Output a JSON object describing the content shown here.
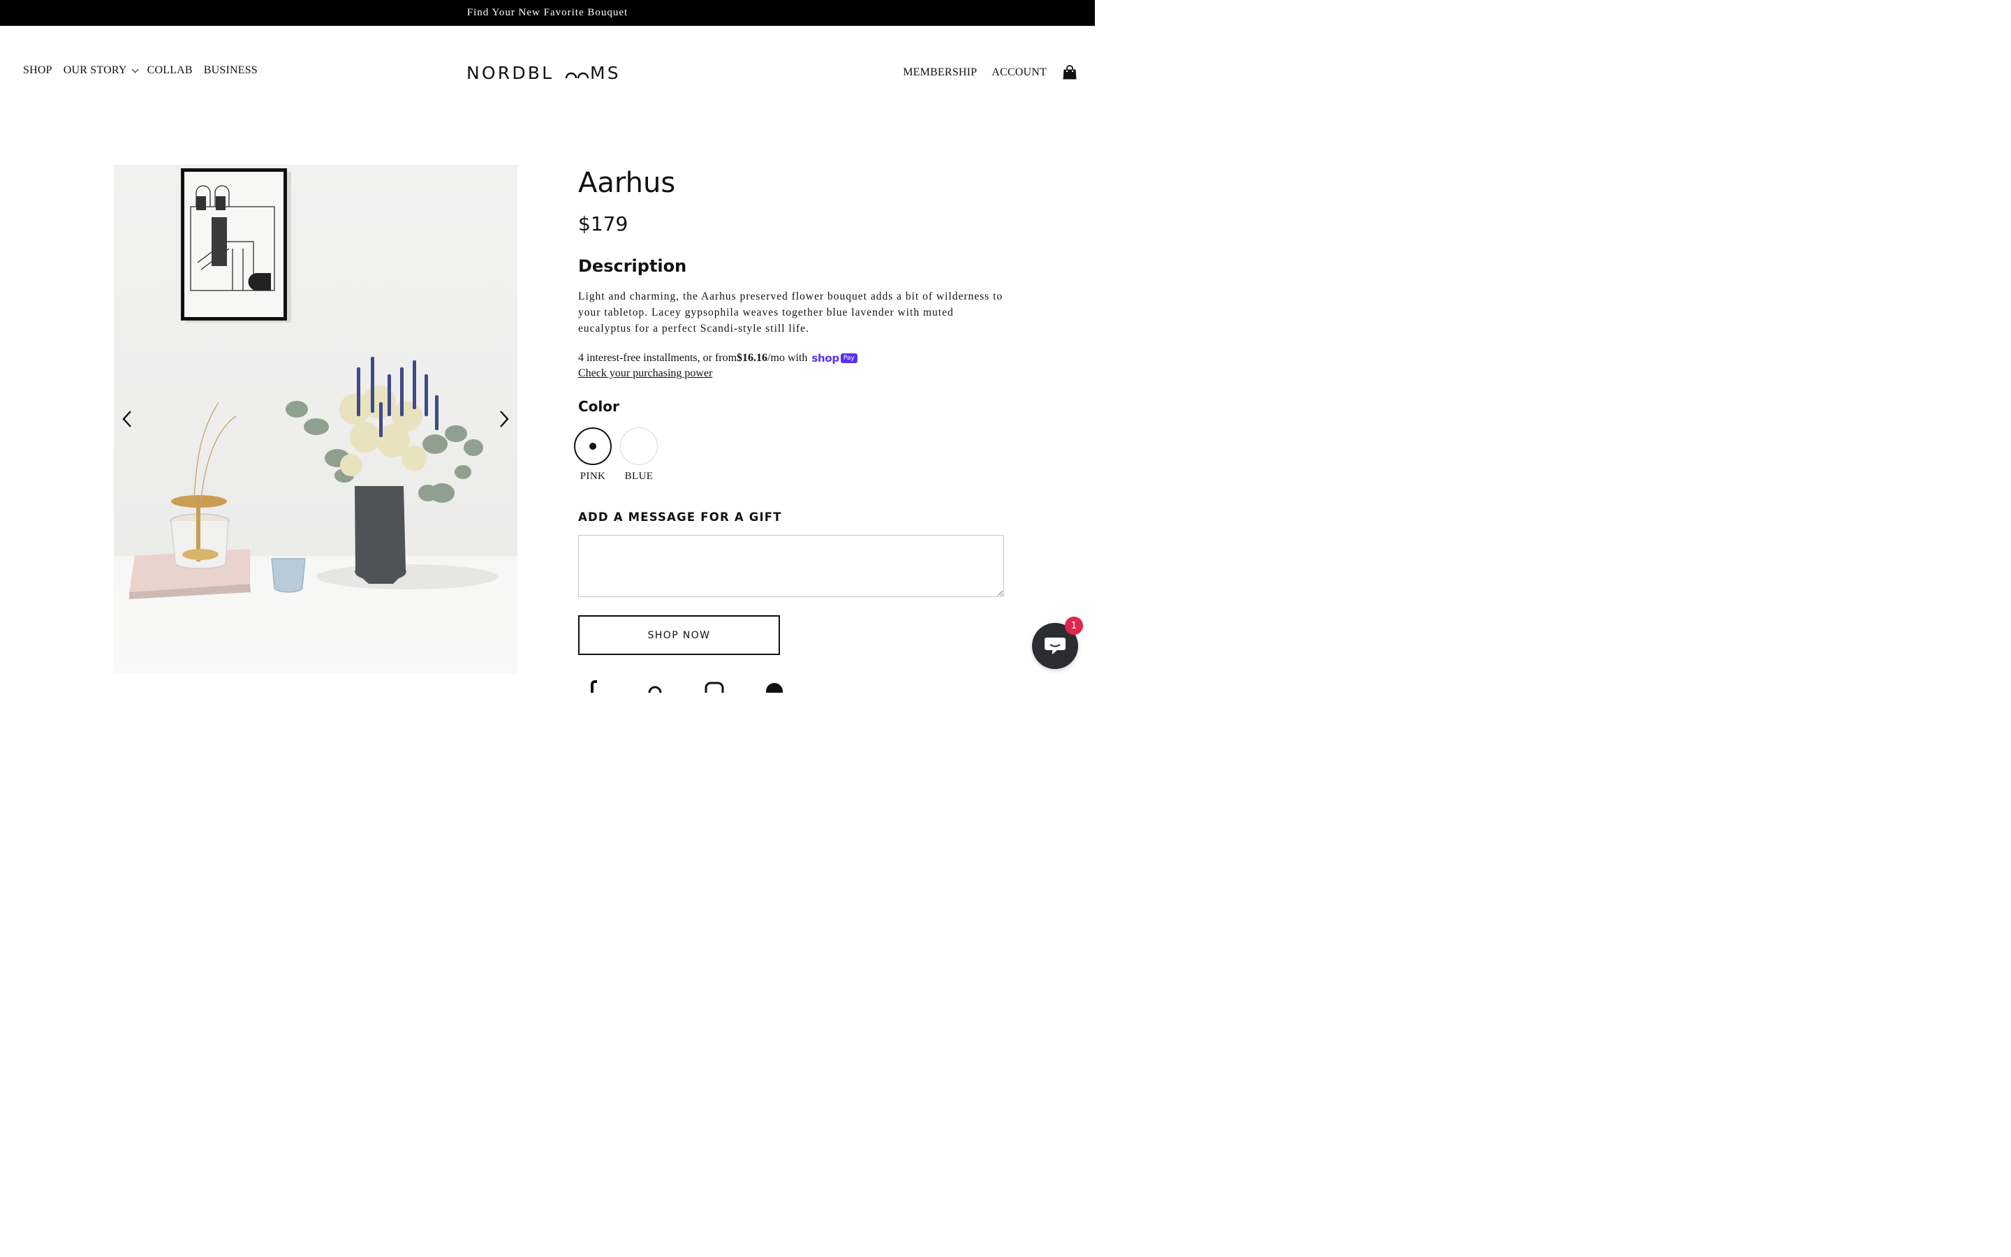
{
  "announcement": "Find Your New Favorite Bouquet",
  "nav_left": [
    {
      "label": "SHOP"
    },
    {
      "label": "OUR STORY"
    },
    {
      "label": "COLLAB"
    },
    {
      "label": "BUSINESS"
    }
  ],
  "logo": "NORDBLOOMS",
  "nav_right": [
    {
      "label": "MEMBERSHIP"
    },
    {
      "label": "ACCOUNT"
    }
  ],
  "cart_icon": "shopping-bag-icon",
  "product": {
    "title": "Aarhus",
    "price": "$179",
    "description_heading": "Description",
    "description": "Light and charming, the Aarhus preserved flower bouquet adds a bit of wilderness to your tabletop. Lacey gypsophila weaves together blue lavender with muted eucalyptus for a perfect Scandi-style still life.",
    "installments_prefix": "4 interest-free installments, or from ",
    "installments_amount": "$16.16",
    "installments_suffix": "/mo with",
    "shop_pay_shop": "shop",
    "shop_pay_pay": "Pay",
    "purchasing_power": "Check your purchasing power",
    "color_heading": "Color",
    "colors": [
      {
        "label": "PINK",
        "selected": true
      },
      {
        "label": "BLUE",
        "selected": false
      }
    ],
    "gift_heading": "ADD A MESSAGE FOR A GIFT",
    "gift_value": "",
    "shop_button": "SHOP NOW"
  },
  "chat_badge": "1",
  "colors": {
    "announcement_bg": "#000000",
    "shop_pay": "#5a31f4",
    "chat_bg": "#2c2d31",
    "badge": "#e0264a"
  }
}
